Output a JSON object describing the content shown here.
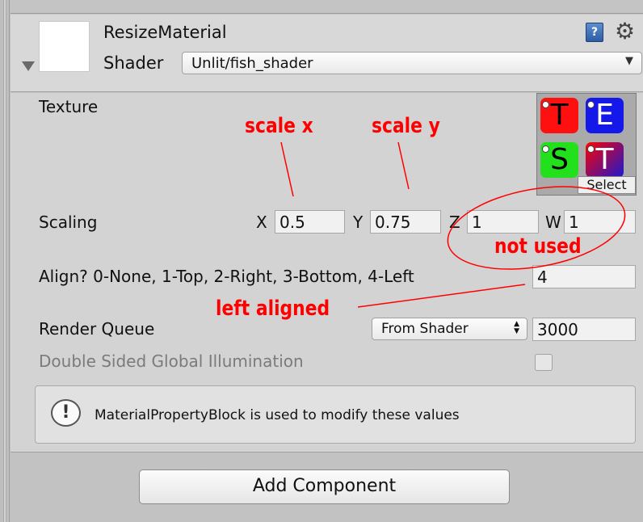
{
  "header": {
    "material_name": "ResizeMaterial",
    "shader_label": "Shader",
    "shader_value": "Unlit/fish_shader",
    "help_icon": "book-help-icon",
    "settings_icon": "gear-icon"
  },
  "properties": {
    "texture_label": "Texture",
    "texture_tiles": [
      "T",
      "E",
      "S",
      "T"
    ],
    "texture_select_label": "Select",
    "scaling_label": "Scaling",
    "x_label": "X",
    "x_value": "0.5",
    "y_label": "Y",
    "y_value": "0.75",
    "z_label": "Z",
    "z_value": "1",
    "w_label": "W",
    "w_value": "1",
    "align_label": "Align? 0-None, 1-Top, 2-Right, 3-Bottom, 4-Left",
    "align_value": "4",
    "render_queue_label": "Render Queue",
    "render_queue_mode": "From Shader",
    "render_queue_value": "3000",
    "double_sided_label": "Double Sided Global Illumination",
    "double_sided_checked": false
  },
  "help_box": {
    "icon": "info-exclamation-icon",
    "message": "MaterialPropertyBlock is used to modify these values"
  },
  "footer": {
    "add_component_label": "Add Component"
  },
  "annotations": {
    "scale_x": "scale x",
    "scale_y": "scale y",
    "not_used": "not used",
    "left_aligned": "left aligned",
    "color": "#ff0000"
  }
}
